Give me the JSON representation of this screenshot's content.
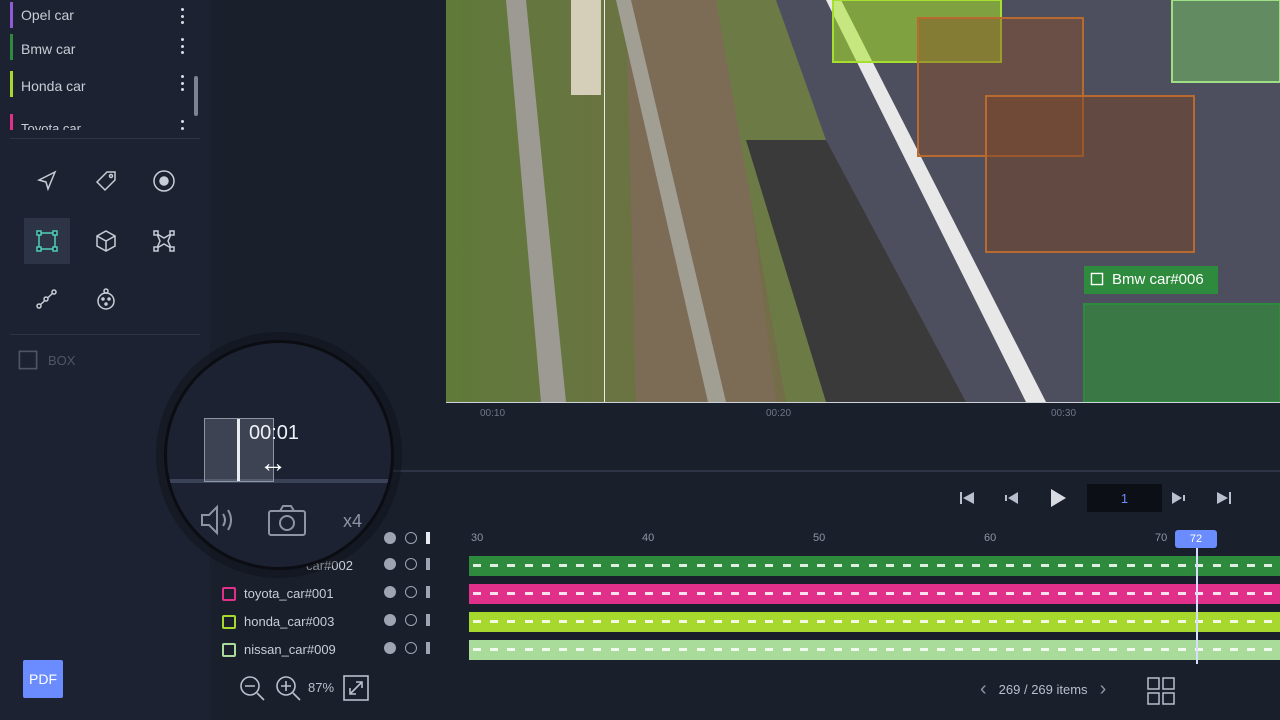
{
  "sidebar": {
    "classes": [
      {
        "label": "Opel car",
        "color": "#8f5bd6"
      },
      {
        "label": "Bmw car",
        "color": "#2e8b3e"
      },
      {
        "label": "Honda car",
        "color": "#a6d82e"
      },
      {
        "label": "Toyota car",
        "color": "#e0308a"
      }
    ],
    "tools": [
      "navigate-icon",
      "tag-icon",
      "point-icon",
      "bounding-box-icon",
      "cuboid-icon",
      "polygon-icon",
      "polyline-icon",
      "keypoint-icon"
    ],
    "box_label": "BOX",
    "pdf_label": "PDF"
  },
  "video": {
    "annotation_label": "Bmw car#006",
    "timeline_ticks": [
      "00:10",
      "00:20",
      "00:30"
    ]
  },
  "controls": {
    "frame_value": "1"
  },
  "magnifier": {
    "time": "00:01",
    "speed": "x4"
  },
  "timeline": {
    "ruler": [
      "30",
      "40",
      "50",
      "60",
      "70"
    ],
    "current_frame": "72",
    "rows": [
      {
        "name": "car#002",
        "color": "#2e8b3e"
      },
      {
        "name": "toyota_car#001",
        "color": "#e0308a"
      },
      {
        "name": "honda_car#003",
        "color": "#a6d82e"
      },
      {
        "name": "nissan_car#009",
        "color": "#a9dc9a"
      }
    ]
  },
  "footer": {
    "zoom": "87%",
    "items": "269 / 269 items"
  }
}
